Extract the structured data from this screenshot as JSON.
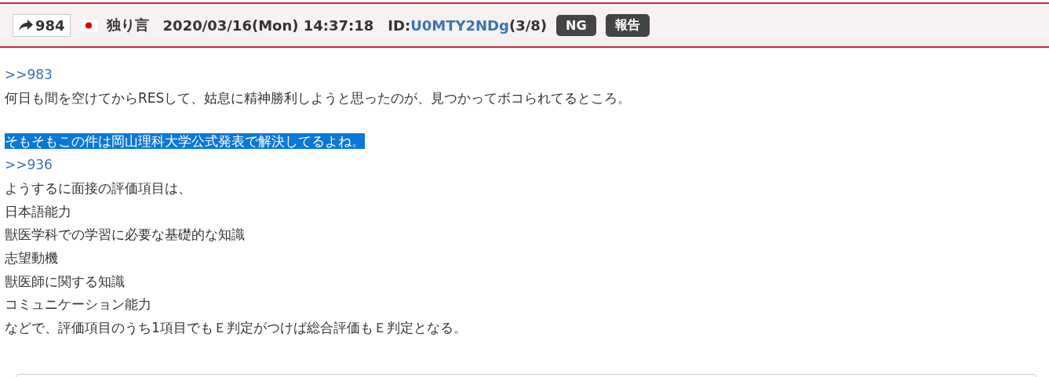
{
  "post_header": {
    "reply_count": "984",
    "name": "独り言",
    "datetime": "2020/03/16(Mon) 14:37:18",
    "id_label": "ID:",
    "id_value": "U0MTY2NDg",
    "id_count": "(3/8)",
    "buttons": [
      "NG",
      "報告"
    ]
  },
  "body": [
    {
      "kind": "anchor",
      "text": ">>983",
      "selected": false
    },
    {
      "kind": "text",
      "text": "何日も間を空けてからRESして、姑息に精神勝利しようと思ったのが、見つかってボコられてるところ。",
      "selected": false
    },
    {
      "kind": "gap"
    },
    {
      "kind": "text",
      "text": "そもそもこの件は岡山理科大学公式発表で解決してるよね。",
      "selected": true
    },
    {
      "kind": "anchor",
      "text": ">>936",
      "selected": false
    },
    {
      "kind": "text",
      "text": "ようするに面接の評価項目は、",
      "selected": false
    },
    {
      "kind": "text",
      "text": "日本語能力",
      "selected": false
    },
    {
      "kind": "text",
      "text": "獣医学科での学習に必要な基礎的な知識",
      "selected": false
    },
    {
      "kind": "text",
      "text": "志望動機",
      "selected": false
    },
    {
      "kind": "text",
      "text": "獣医師に関する知識",
      "selected": false
    },
    {
      "kind": "text",
      "text": "コミュニケーション能力",
      "selected": false
    },
    {
      "kind": "text",
      "text": "などで、評価項目のうち1項目でもＥ判定がつけば総合評価もＥ判定となる。",
      "selected": false
    }
  ]
}
